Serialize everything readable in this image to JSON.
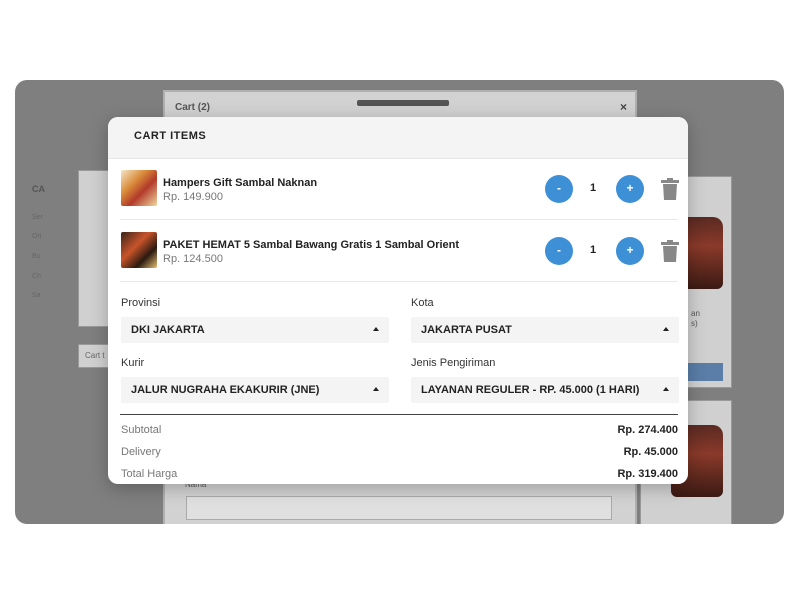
{
  "background": {
    "old_modal_title": "Cart (2)",
    "old_modal_close": "×",
    "left_heading": "CA",
    "left_rows": [
      "Ser",
      "Ori",
      "Bu",
      "Ch",
      "Sa"
    ],
    "left_button": "Cart t",
    "right_labels": [
      "an",
      "s)"
    ],
    "name_label": "Nama"
  },
  "modal": {
    "title": "CART ITEMS"
  },
  "items": [
    {
      "name": "Hampers Gift Sambal Naknan",
      "price": "Rp. 149.900",
      "qty": "1",
      "minus": "-",
      "plus": "+"
    },
    {
      "name": "PAKET HEMAT 5 Sambal Bawang Gratis 1 Sambal Orient",
      "price": "Rp. 124.500",
      "qty": "1",
      "minus": "-",
      "plus": "+"
    }
  ],
  "form": {
    "provinsi_label": "Provinsi",
    "provinsi_value": "DKI JAKARTA",
    "kota_label": "Kota",
    "kota_value": "JAKARTA PUSAT",
    "kurir_label": "Kurir",
    "kurir_value": "JALUR NUGRAHA EKAKURIR (JNE)",
    "jenis_label": "Jenis Pengiriman",
    "jenis_value": "LAYANAN REGULER - RP. 45.000 (1 HARI)"
  },
  "summary": {
    "subtotal_label": "Subtotal",
    "subtotal_value": "Rp. 274.400",
    "delivery_label": "Delivery",
    "delivery_value": "Rp. 45.000",
    "total_label": "Total Harga",
    "total_value": "Rp. 319.400"
  },
  "colors": {
    "accent": "#3d8fd6",
    "overlay": "#7f7f7f"
  }
}
